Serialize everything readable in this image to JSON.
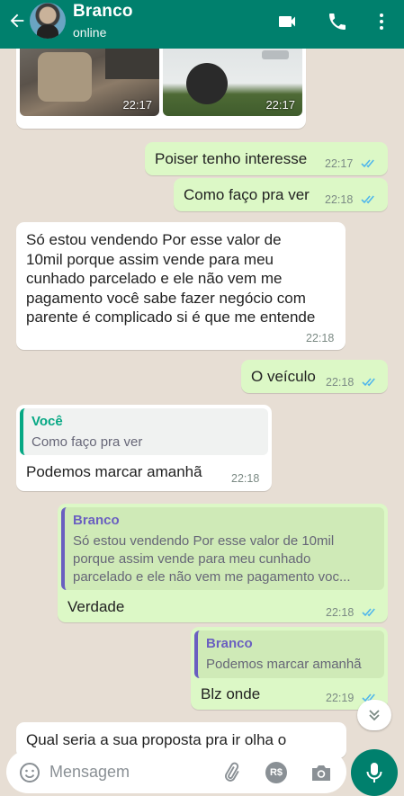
{
  "header": {
    "contact_name": "Branco",
    "status": "online"
  },
  "photos": [
    {
      "time": "22:17"
    },
    {
      "time": "22:17"
    }
  ],
  "messages": [
    {
      "text": "Poiser tenho interesse",
      "time": "22:17"
    },
    {
      "text": "Como faço pra ver",
      "time": "22:18"
    },
    {
      "lines": [
        "Só estou vendendo Por esse valor de",
        "10mil porque assim vende para meu",
        "cunhado parcelado e ele não vem me",
        "pagamento você sabe fazer negócio com",
        "parente é complicado si é que me entende"
      ],
      "time": "22:18"
    },
    {
      "text": "O veículo",
      "time": "22:18"
    },
    {
      "quote_name": "Você",
      "quote_text": "Como faço pra ver",
      "text": "Podemos marcar amanhã",
      "time": "22:18"
    },
    {
      "quote_name": "Branco",
      "quote_lines": [
        "Só estou vendendo Por esse valor de 10mil",
        "porque assim vende para meu cunhado",
        "parcelado e ele não vem me pagamento voc..."
      ],
      "text": "Verdade",
      "time": "22:18"
    },
    {
      "quote_name": "Branco",
      "quote_text": "Podemos marcar amanhã",
      "text": "Blz onde",
      "time": "22:19"
    },
    {
      "text": "Qual seria a sua proposta pra ir olha o"
    }
  ],
  "input": {
    "placeholder": "Mensagem",
    "currency_badge": "R$"
  },
  "colors": {
    "header": "#00806d",
    "outgoing_bubble": "#dcf8c6",
    "incoming_bubble": "#ffffff",
    "read_ticks": "#4fb6ec",
    "quote_you": "#06a884",
    "quote_other": "#6a5fc0"
  }
}
